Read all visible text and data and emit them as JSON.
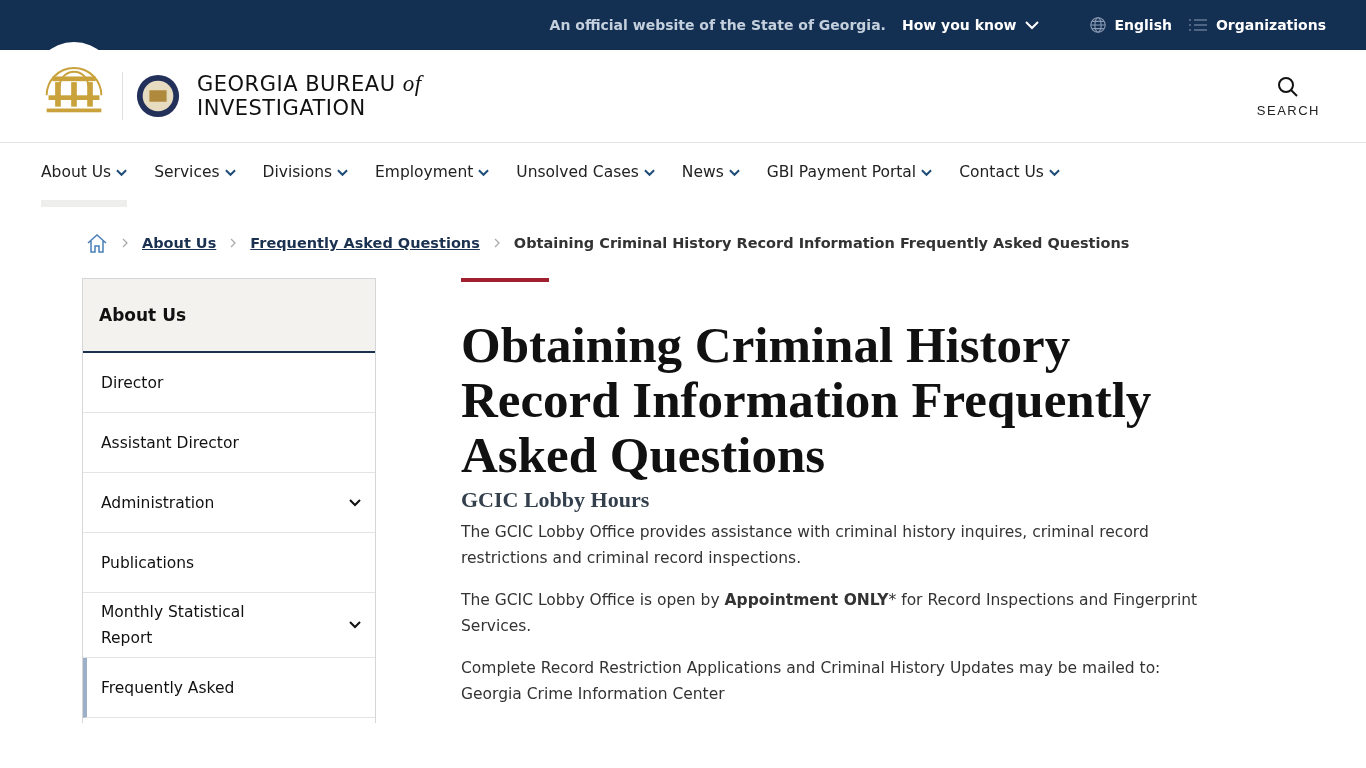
{
  "top_bar": {
    "notice": "An official website of the State of Georgia.",
    "how_you_know": "How you know",
    "language": "English",
    "organizations": "Organizations"
  },
  "header": {
    "title_line_1": "GEORGIA BUREAU",
    "title_of": "of",
    "title_line_2": "INVESTIGATION",
    "search_label": "SEARCH"
  },
  "nav": [
    {
      "label": "About Us",
      "selected": true
    },
    {
      "label": "Services",
      "selected": false
    },
    {
      "label": "Divisions",
      "selected": false
    },
    {
      "label": "Employment",
      "selected": false
    },
    {
      "label": "Unsolved Cases",
      "selected": false
    },
    {
      "label": "News",
      "selected": false
    },
    {
      "label": "GBI Payment Portal",
      "selected": false
    },
    {
      "label": "Contact Us",
      "selected": false
    }
  ],
  "breadcrumb": {
    "links": [
      "About Us",
      "Frequently Asked Questions"
    ],
    "current": "Obtaining Criminal History Record Information Frequently Asked Questions"
  },
  "sidebar": {
    "title": "About Us",
    "items": [
      {
        "label": "Director",
        "has_submenu": false,
        "selected": false
      },
      {
        "label": "Assistant Director",
        "has_submenu": false,
        "selected": false
      },
      {
        "label": "Administration",
        "has_submenu": true,
        "selected": false
      },
      {
        "label": "Publications",
        "has_submenu": false,
        "selected": false
      },
      {
        "label": "Monthly Statistical Report",
        "has_submenu": true,
        "selected": false
      },
      {
        "label": "Frequently Asked",
        "has_submenu": false,
        "selected": true
      }
    ]
  },
  "article": {
    "title": "Obtaining Criminal History Record Information Frequently Asked Questions",
    "subtitle": "GCIC Lobby Hours",
    "paragraphs": [
      {
        "lines": [
          "The GCIC Lobby Office provides assistance with criminal history inquires, criminal record restrictions and criminal record inspections."
        ]
      },
      {
        "lines": [
          "The GCIC Lobby Office is open by **Appointment ONLY*** for Record Inspections and Fingerprint Services."
        ]
      },
      {
        "lines": [
          "Complete Record Restriction Applications and Criminal History Updates may be mailed to:",
          "Georgia Crime Information Center"
        ]
      }
    ]
  }
}
